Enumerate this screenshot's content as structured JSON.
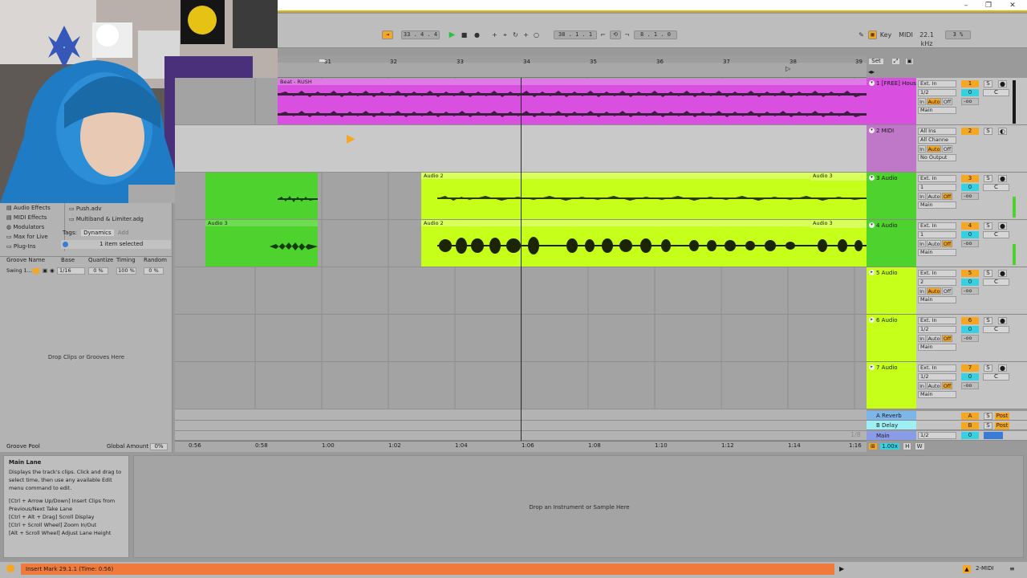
{
  "transport": {
    "position": "33 . 4 . 4",
    "loop_start": "38 . 1 . 1",
    "loop_length": "8 . 1 . 0",
    "key_label": "Key",
    "midi_label": "MIDI",
    "sample_rate": "22.1 kHz",
    "cpu": "3 %"
  },
  "ruler": {
    "bars": [
      "31",
      "32",
      "33",
      "34",
      "35",
      "36",
      "37",
      "38",
      "39"
    ],
    "set_label": "Set"
  },
  "browser": {
    "categories": [
      "Audio Effects",
      "MIDI Effects",
      "Modulators",
      "Max for Live",
      "Plug-Ins"
    ],
    "files": [
      "Push.adv",
      "Multiband & Limiter.adg"
    ],
    "tags_label": "Tags:",
    "tag_chip": "Dynamics",
    "tag_add": "Add",
    "selection_info": "1 item selected"
  },
  "groove": {
    "headers": [
      "Groove Name",
      "Base",
      "Quantize",
      "Timing",
      "Random"
    ],
    "row": {
      "name": "Swing 1...",
      "base": "1/16",
      "quantize": "0 %",
      "timing": "100 %",
      "random": "0 %"
    },
    "drop_hint": "Drop Clips or Grooves Here",
    "pool_label": "Groove Pool",
    "global_amount_label": "Global Amount",
    "global_amount": "0%"
  },
  "clips": {
    "beat": "Beat - RUSH",
    "audio2_a": "Audio 2",
    "audio3_a": "Audio 3",
    "audio3_b": "Audio 3",
    "audio2_b": "Audio 2",
    "audio3_c": "Audio 3"
  },
  "tracks": [
    {
      "name": "1 [FREE] Hous",
      "input": "Ext. In",
      "channel": "1/2",
      "output": "Main",
      "number": "1",
      "pan": "C"
    },
    {
      "name": "2 MIDI",
      "input": "All Ins",
      "channel": "All Channe",
      "output": "No Output",
      "number": "2",
      "pan": ""
    },
    {
      "name": "3 Audio",
      "input": "Ext. In",
      "channel": "1",
      "output": "Main",
      "number": "3",
      "pan": "C"
    },
    {
      "name": "4 Audio",
      "input": "Ext. In",
      "channel": "1",
      "output": "Main",
      "number": "4",
      "pan": "C"
    },
    {
      "name": "5 Audio",
      "input": "Ext. In",
      "channel": "2",
      "output": "Main",
      "number": "5",
      "pan": "C"
    },
    {
      "name": "6 Audio",
      "input": "Ext. In",
      "channel": "1/2",
      "output": "Main",
      "number": "6",
      "pan": "C"
    },
    {
      "name": "7 Audio",
      "input": "Ext. In",
      "channel": "1/2",
      "output": "Main",
      "number": "7",
      "pan": "C"
    }
  ],
  "monitor": {
    "in": "In",
    "auto": "Auto",
    "off": "Off",
    "vol": "0",
    "send": "-oo"
  },
  "returns": [
    {
      "name": "A Reverb",
      "letter": "A",
      "post": "Post"
    },
    {
      "name": "B Delay",
      "letter": "B",
      "post": "Post"
    }
  ],
  "main": {
    "name": "Main",
    "channel": "1/2",
    "vol": "0",
    "zoom": "1.00x",
    "grid": "1/8"
  },
  "time_ruler": [
    "0:56",
    "0:58",
    "1:00",
    "1:02",
    "1:04",
    "1:06",
    "1:08",
    "1:10",
    "1:12",
    "1:14",
    "1:16"
  ],
  "info": {
    "title": "Main Lane",
    "body": "Displays the track's clips. Click and drag to select time, then use any available Edit menu command to edit.",
    "shortcuts": [
      "[Ctrl + Arrow Up/Down] Insert Clips from Previous/Next Take Lane",
      "[Ctrl + Alt + Drag] Scroll Display",
      "[Ctrl + Scroll Wheel] Zoom In/Out",
      "[Alt + Scroll Wheel] Adjust Lane Height"
    ]
  },
  "detail": {
    "drop_hint": "Drop an Instrument or Sample Here"
  },
  "status": {
    "message": "Insert Mark 29.1.1 (Time: 0:56)",
    "track": "2-MIDI"
  },
  "colors": {
    "beat": "#d94fe0",
    "audio": "#c6ff1a",
    "green": "#4ed22e",
    "orange": "#f5a623",
    "cyan": "#36d0e0",
    "accent": "#e4b200"
  }
}
